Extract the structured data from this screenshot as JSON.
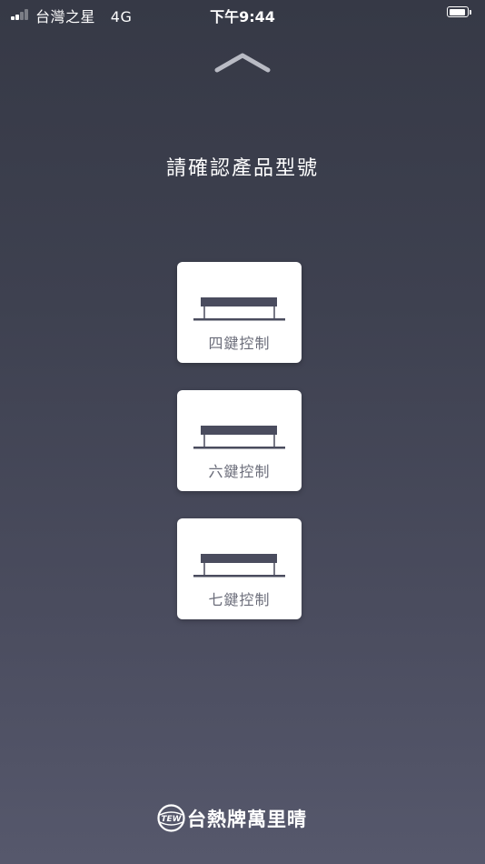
{
  "status_bar": {
    "carrier": "台灣之星",
    "network": "4G",
    "time": "下午9:44"
  },
  "header": {
    "collapse_icon": "chevron-up-icon",
    "title": "請確認產品型號"
  },
  "options": [
    {
      "label": "四鍵控制",
      "icon": "switch-panel-icon"
    },
    {
      "label": "六鍵控制",
      "icon": "switch-panel-icon"
    },
    {
      "label": "七鍵控制",
      "icon": "switch-panel-icon"
    }
  ],
  "footer": {
    "logo_text": "TEW",
    "brand_name": "台熱牌萬里晴"
  },
  "colors": {
    "background_top": "#363946",
    "background_bottom": "#56586c",
    "card": "#ffffff",
    "icon": "#4a4c5e",
    "label": "#6b6d7a"
  }
}
